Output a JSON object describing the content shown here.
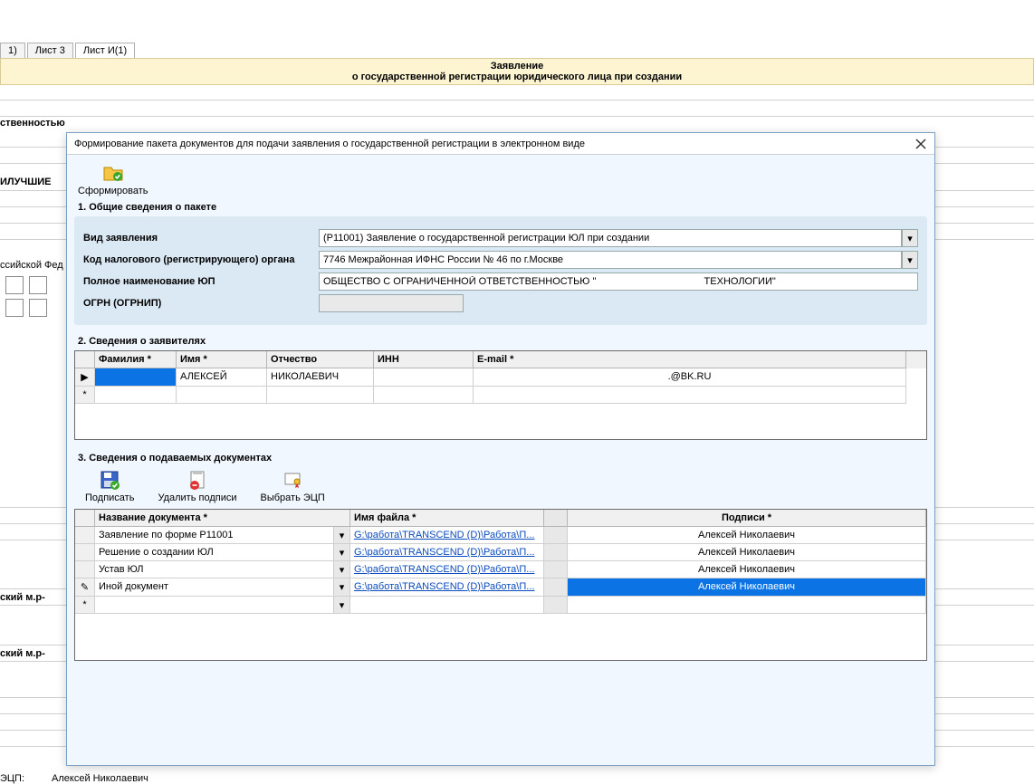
{
  "background": {
    "tabs": [
      "1)",
      "Лист 3",
      "Лист И(1)"
    ],
    "active_tab": 2,
    "header_line1": "Заявление",
    "header_line2": "о государственной регистрации юридического лица при создании",
    "cut_text1": "ственностью",
    "cut_text2": "ИЛУЧШИЕ",
    "cut_text3": "ссийской Фед",
    "cut_text4": "ский м.р-",
    "cut_text5": "ский м.р-",
    "footer_left": "ЭЦП:",
    "footer_right": "Алексей Николаевич"
  },
  "dialog": {
    "title": "Формирование пакета документов для подачи заявления о государственной регистрации в электронном виде",
    "generate_btn": "Сформировать",
    "section1": {
      "title": "1. Общие сведения о пакете",
      "labels": {
        "type": "Вид заявления",
        "code": "Код налогового (регистрирующего) органа",
        "full_name": "Полное наименование ЮП",
        "ogrn": "ОГРН (ОГРНИП)"
      },
      "values": {
        "type": "(Р11001) Заявление о государственной регистрации ЮЛ при создании",
        "code": "7746 Межрайонная ИФНС России № 46 по г.Москве",
        "full_name": "ОБЩЕСТВО С ОГРАНИЧЕННОЙ ОТВЕТСТВЕННОСТЬЮ \"                                       ТЕХНОЛОГИИ\"",
        "ogrn": ""
      }
    },
    "section2": {
      "title": "2. Сведения о заявителях",
      "columns": {
        "fam": "Фамилия *",
        "name": "Имя *",
        "patr": "Отчество",
        "inn": "ИНН",
        "email": "E-mail *"
      },
      "rows": [
        {
          "fam": "",
          "name": "АЛЕКСЕЙ",
          "patr": "НИКОЛАЕВИЧ",
          "inn": "",
          "email": ".@BK.RU"
        }
      ]
    },
    "section3": {
      "title": "3.  Сведения о подаваемых документах",
      "toolbar": {
        "sign": "Подписать",
        "delete": "Удалить подписи",
        "choose": "Выбрать ЭЦП"
      },
      "columns": {
        "doc": "Название документа *",
        "file": "Имя файла *",
        "sign": "Подписи *"
      },
      "rows": [
        {
          "doc": "Заявление по форме Р11001",
          "file": "G:\\работа\\TRANSCEND (D)\\Работа\\П...",
          "signer": "Алексей Николаевич"
        },
        {
          "doc": "Решение о создании ЮЛ",
          "file": "G:\\работа\\TRANSCEND (D)\\Работа\\П...",
          "signer": "Алексей Николаевич"
        },
        {
          "doc": "Устав ЮЛ",
          "file": "G:\\работа\\TRANSCEND (D)\\Работа\\П...",
          "signer": "Алексей Николаевич"
        },
        {
          "doc": "Иной документ",
          "file": "G:\\работа\\TRANSCEND (D)\\Работа\\П...",
          "signer": "Алексей Николаевич"
        }
      ],
      "selected_index": 3
    }
  }
}
